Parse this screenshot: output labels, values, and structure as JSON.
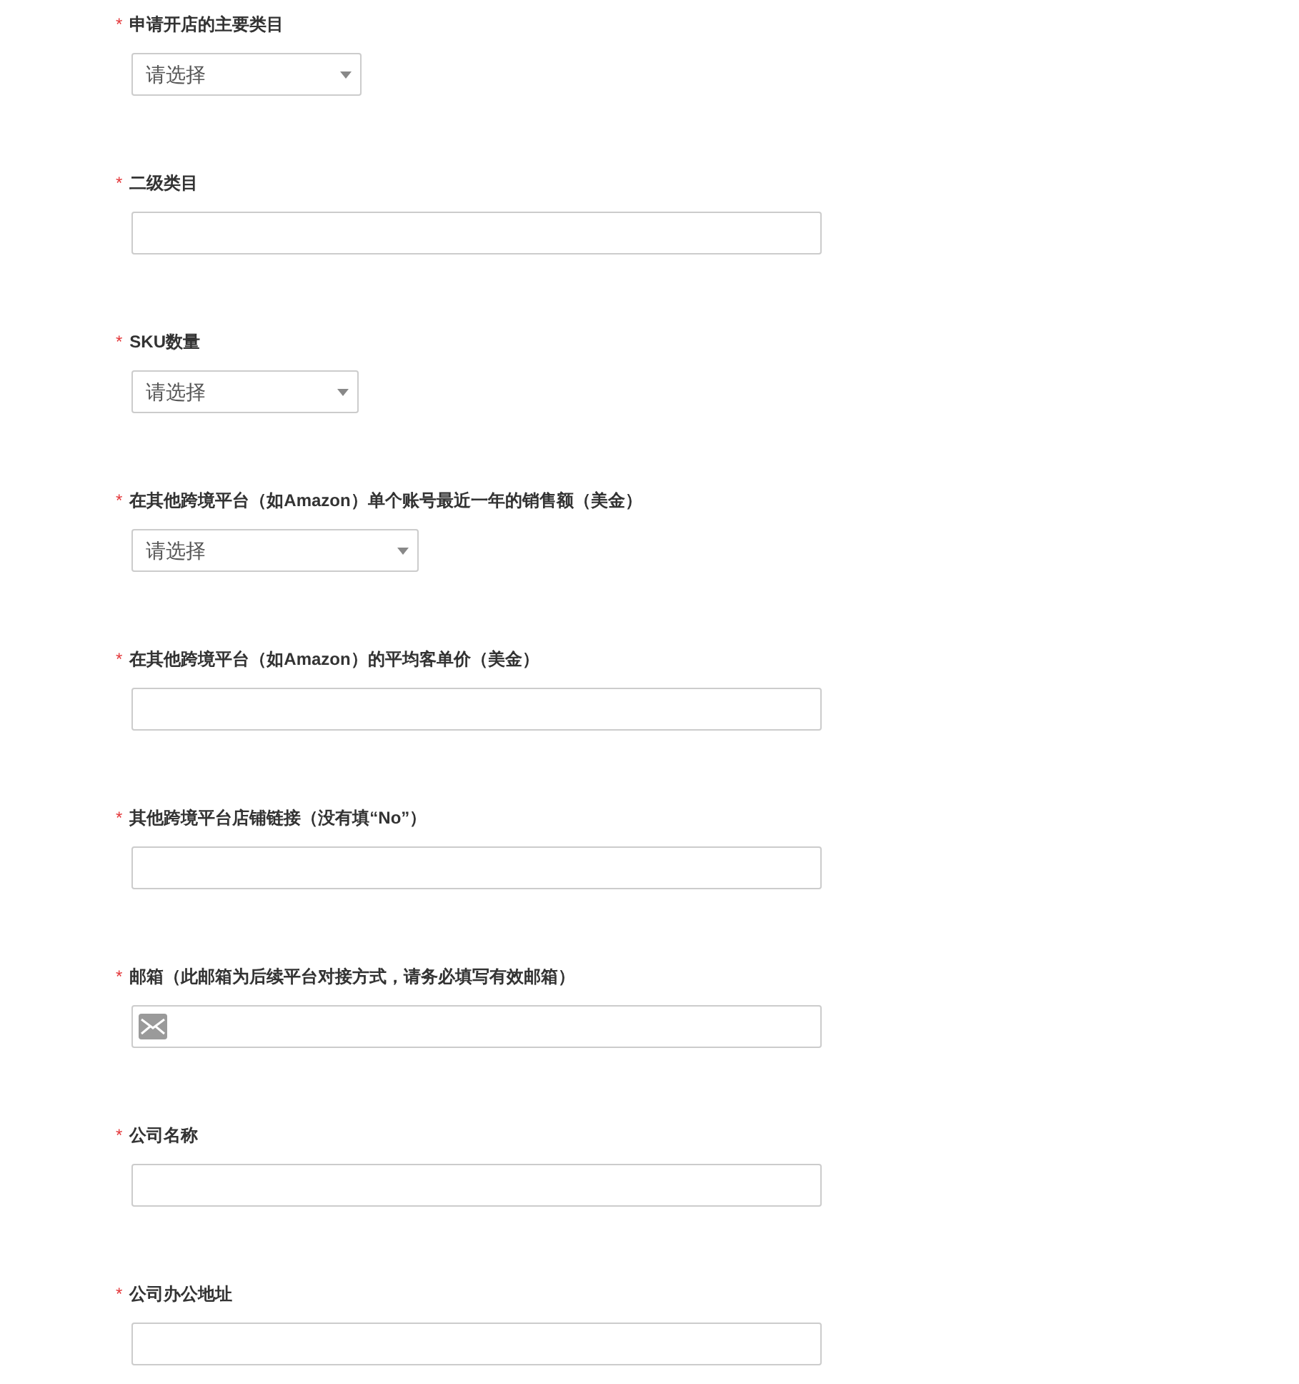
{
  "fields": [
    {
      "kind": "select",
      "required_mark": "*",
      "label": "申请开店的主要类目",
      "placeholder": "请选择"
    },
    {
      "kind": "text",
      "required_mark": "*",
      "label": "二级类目"
    },
    {
      "kind": "select",
      "required_mark": "*",
      "label": "SKU数量",
      "placeholder": "请选择"
    },
    {
      "kind": "select",
      "required_mark": "*",
      "label": "在其他跨境平台（如Amazon）单个账号最近一年的销售额（美金）",
      "placeholder": "请选择"
    },
    {
      "kind": "text",
      "required_mark": "*",
      "label": "在其他跨境平台（如Amazon）的平均客单价（美金）"
    },
    {
      "kind": "text",
      "required_mark": "*",
      "label": "其他跨境平台店铺链接（没有填“No”）"
    },
    {
      "kind": "email",
      "required_mark": "*",
      "label": "邮箱（此邮箱为后续平台对接方式，请务必填写有效邮箱）"
    },
    {
      "kind": "text",
      "required_mark": "*",
      "label": "公司名称"
    },
    {
      "kind": "text",
      "required_mark": "*",
      "label": "公司办公地址"
    }
  ]
}
